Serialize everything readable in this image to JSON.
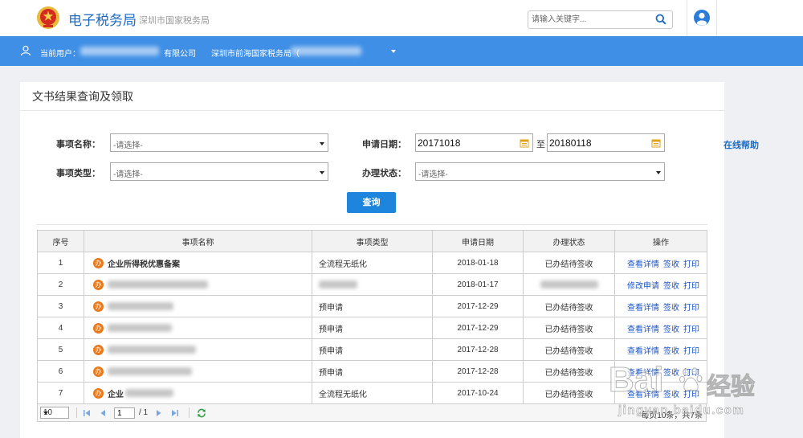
{
  "header": {
    "site_title": "电子税务局",
    "site_subtitle": "深圳市国家税务局",
    "search_placeholder": "请输入关键字..."
  },
  "user_bar": {
    "current_user_label": "当前用户：",
    "company_suffix": "有限公司",
    "tax_bureau": "深圳市前海国家税务局（"
  },
  "panel": {
    "title": "文书结果查询及领取"
  },
  "form": {
    "item_name": {
      "label": "事项名称：",
      "value": "-请选择-"
    },
    "apply_date": {
      "label": "申请日期：",
      "from": "20171018",
      "separator": "至",
      "to": "20180118"
    },
    "item_type": {
      "label": "事项类型：",
      "value": "-请选择-"
    },
    "status": {
      "label": "办理状态：",
      "value": "-请选择-"
    },
    "query_button": "查询",
    "help_link": "在线帮助"
  },
  "table": {
    "columns": [
      "序号",
      "事项名称",
      "事项类型",
      "申请日期",
      "办理状态",
      "操作"
    ],
    "badge": "办",
    "rows": [
      {
        "no": "1",
        "name": "企业所得税优惠备案",
        "type": "全流程无纸化",
        "date": "2018-01-18",
        "status": "已办结待签收",
        "actions": [
          "查看详情",
          "签收",
          "打印"
        ]
      },
      {
        "no": "2",
        "date": "2018-01-17",
        "actions": [
          "修改申请",
          "签收",
          "打印"
        ]
      },
      {
        "no": "3",
        "type": "预申请",
        "date": "2017-12-29",
        "status": "已办结待签收",
        "actions": [
          "查看详情",
          "签收",
          "打印"
        ]
      },
      {
        "no": "4",
        "type": "预申请",
        "date": "2017-12-29",
        "status": "已办结待签收",
        "actions": [
          "查看详情",
          "签收",
          "打印"
        ]
      },
      {
        "no": "5",
        "type": "预申请",
        "date": "2017-12-28",
        "status": "已办结待签收",
        "actions": [
          "查看详情",
          "签收",
          "打印"
        ]
      },
      {
        "no": "6",
        "type": "预申请",
        "date": "2017-12-28",
        "status": "已办结待签收",
        "actions": [
          "查看详情",
          "签收",
          "打印"
        ]
      },
      {
        "no": "7",
        "name": "企业",
        "type": "全流程无纸化",
        "date": "2017-10-24",
        "status": "已办结待签收",
        "actions": [
          "查看详情",
          "签收",
          "打印"
        ]
      }
    ]
  },
  "pagination": {
    "page_size": "10",
    "current_page": "1",
    "total_pages": "/ 1",
    "summary": "每页10条，共7条"
  },
  "watermark": {
    "brand": "Bai",
    "product": "经验",
    "url": "jingyan.baidu.com"
  },
  "icons": {
    "logo": "national-emblem",
    "search": "search-icon",
    "avatar": "avatar-icon",
    "user": "user-icon",
    "date": "calendar-icon",
    "dropdown": "chevron-down-icon",
    "pager": [
      "first-page-icon",
      "prev-page-icon",
      "next-page-icon",
      "last-page-icon",
      "refresh-icon"
    ]
  },
  "colors": {
    "brand_blue": "#1d6cc3",
    "user_bar": "#3f8fe6",
    "query_button": "#1d86dc",
    "link": "#1a55c8",
    "badge": "#e87a1d",
    "page_background": "#eef0f4"
  }
}
